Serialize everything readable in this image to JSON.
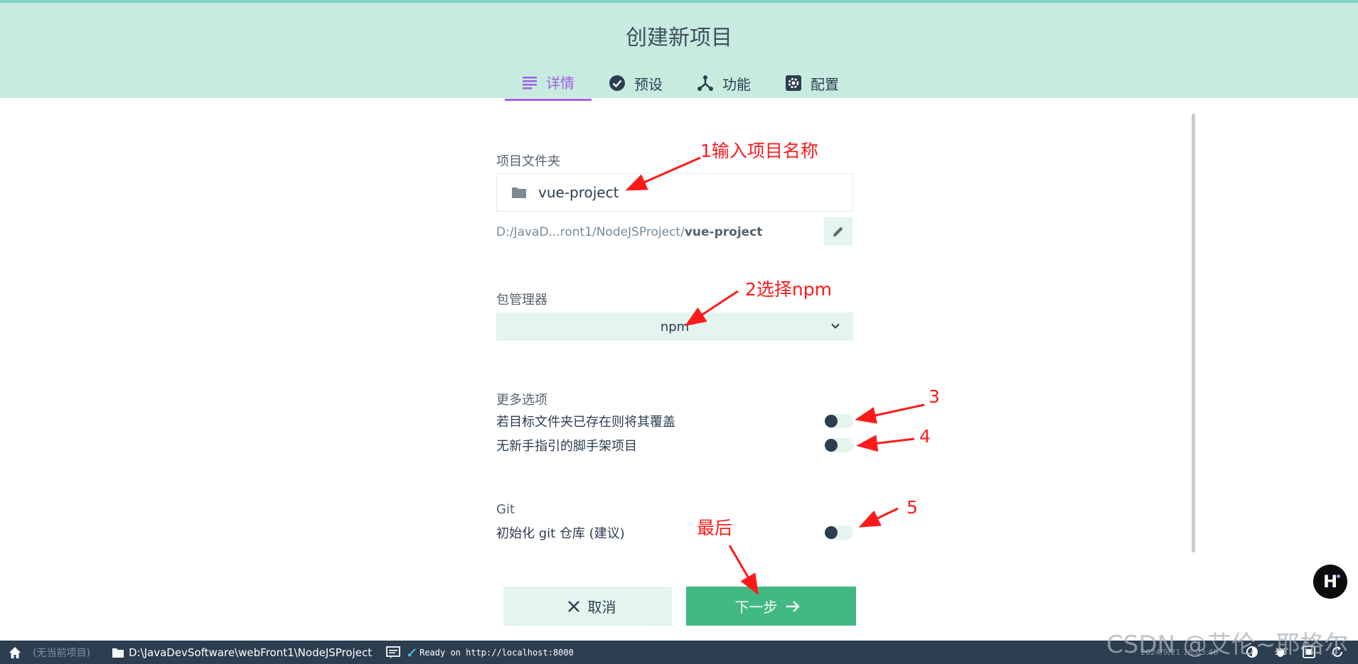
{
  "header": {
    "title": "创建新项目",
    "tabs": [
      {
        "label": "详情",
        "icon": "details-icon",
        "active": true
      },
      {
        "label": "预设",
        "icon": "check-circle-icon",
        "active": false
      },
      {
        "label": "功能",
        "icon": "fork-icon",
        "active": false
      },
      {
        "label": "配置",
        "icon": "gear-icon",
        "active": false
      }
    ]
  },
  "form": {
    "folder_label": "项目文件夹",
    "folder_value": "vue-project",
    "path_prefix": "D:/JavaD...ront1/NodeJSProject/",
    "path_name": "vue-project",
    "package_manager_label": "包管理器",
    "package_manager_value": "npm",
    "more_options_label": "更多选项",
    "option_overwrite": "若目标文件夹已存在则将其覆盖",
    "option_no_guide": "无新手指引的脚手架项目",
    "git_label": "Git",
    "option_git_init": "初始化 git 仓库 (建议)"
  },
  "buttons": {
    "cancel": "取消",
    "next": "下一步"
  },
  "annotations": {
    "a1": "1输入项目名称",
    "a2": "2选择npm",
    "a3": "3",
    "a4": "4",
    "a5": "5",
    "last": "最后"
  },
  "statusbar": {
    "no_project": "(无当前项目)",
    "path": "D:\\JavaDevSoftware\\webFront1\\NodeJSProject",
    "log": "Ready on http://localhost:8000"
  },
  "watermark": "CSDN @艾伦~耶格尔",
  "timestamp": "2024/9/21 16:03:46",
  "colors": {
    "header_bg": "#c8ebe0",
    "accent": "#a05ee6",
    "primary": "#42b983",
    "statusbar_bg": "#2c3e50",
    "annotation": "#ff1a1a"
  }
}
